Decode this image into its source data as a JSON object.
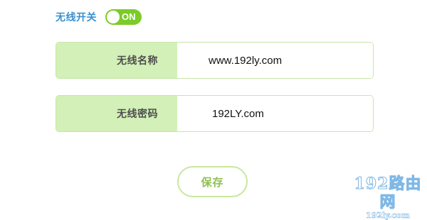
{
  "wireless_switch": {
    "label": "无线开关",
    "state": "ON",
    "enabled": true,
    "on_color": "#7ccb2a"
  },
  "fields": {
    "ssid": {
      "label": "无线名称",
      "value": "www.192ly.com"
    },
    "password": {
      "label": "无线密码",
      "value": "192LY.com"
    }
  },
  "actions": {
    "save_label": "保存"
  },
  "watermark": {
    "main": "192路由网",
    "sub": "192ly.com"
  },
  "colors": {
    "label_blue": "#3a8fd0",
    "field_label_bg": "#d2f0b7",
    "field_border": "#c7e6a8",
    "button_text": "#8ec24f"
  }
}
